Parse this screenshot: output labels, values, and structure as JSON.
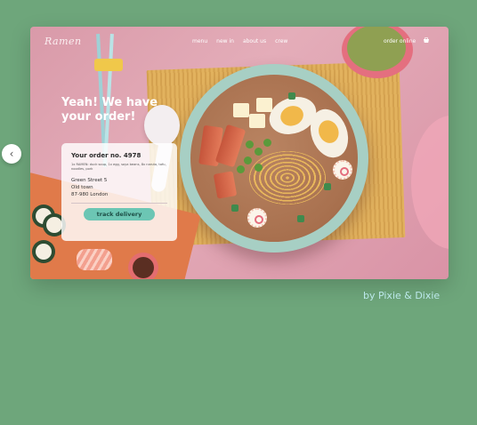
{
  "header": {
    "logo": "Ramen",
    "nav": [
      "menu",
      "new in",
      "about us",
      "crew"
    ],
    "order_online": "order online",
    "cart_icon": "cart-icon"
  },
  "hero": {
    "headline": "Yeah! We have your order!"
  },
  "order": {
    "title": "Your order no. 4978",
    "items": "1x RAMEN: duck soup, 1x egg, soya beans, 8x naruto, tofu, noodles, pork",
    "address_line1": "Green Street 5",
    "address_line2": "Old town",
    "address_line3": "87-980 London",
    "track_button": "track delivery"
  },
  "carousel": {
    "prev_icon": "‹"
  },
  "credit": "by Pixie & Dixie",
  "colors": {
    "background": "#6ea67b",
    "accent": "#6cc6b4",
    "card_pink": "#e4adb9"
  }
}
